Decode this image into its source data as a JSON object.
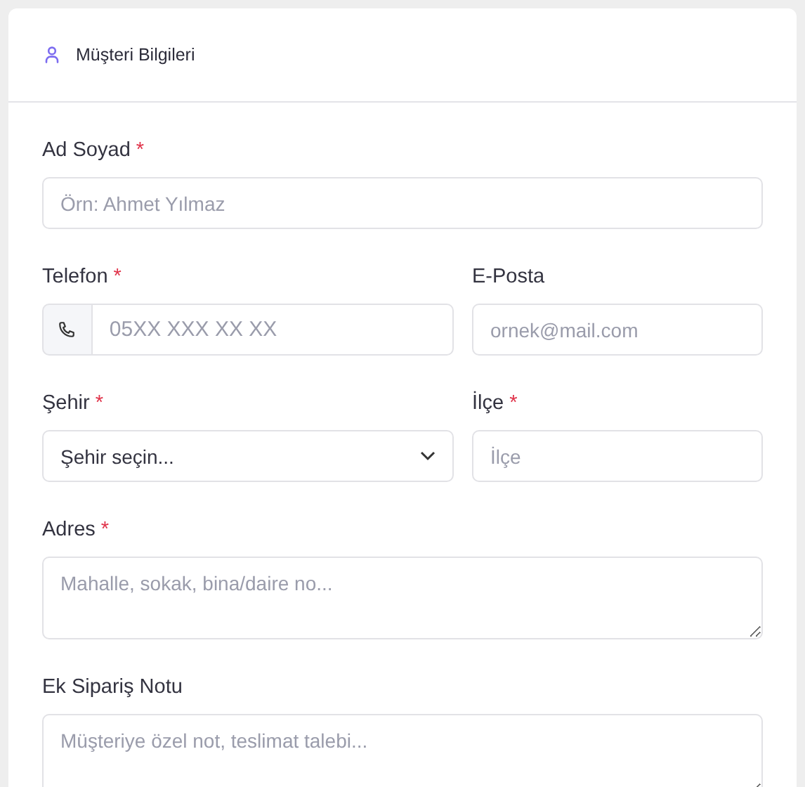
{
  "card": {
    "title": "Müşteri Bilgileri"
  },
  "rows": [
    [
      {
        "kind": "text",
        "label": "Ad Soyad",
        "required_mark": "*",
        "placeholder": "Örn: Ahmet Yılmaz"
      }
    ],
    [
      {
        "kind": "phone",
        "label": "Telefon",
        "required_mark": "*",
        "placeholder": "05XX XXX XX XX"
      },
      {
        "kind": "text",
        "label": "E-Posta",
        "placeholder": "ornek@mail.com"
      }
    ],
    [
      {
        "kind": "select",
        "label": "Şehir",
        "required_mark": "*",
        "value": "Şehir seçin..."
      },
      {
        "kind": "text",
        "label": "İlçe",
        "required_mark": "*",
        "placeholder": "İlçe"
      }
    ],
    [
      {
        "kind": "textarea",
        "label": "Adres",
        "required_mark": "*",
        "placeholder": "Mahalle, sokak, bina/daire no..."
      }
    ],
    [
      {
        "kind": "textarea",
        "label": "Ek Sipariş Notu",
        "placeholder": "Müşteriye özel not, teslimat talebi..."
      }
    ]
  ]
}
